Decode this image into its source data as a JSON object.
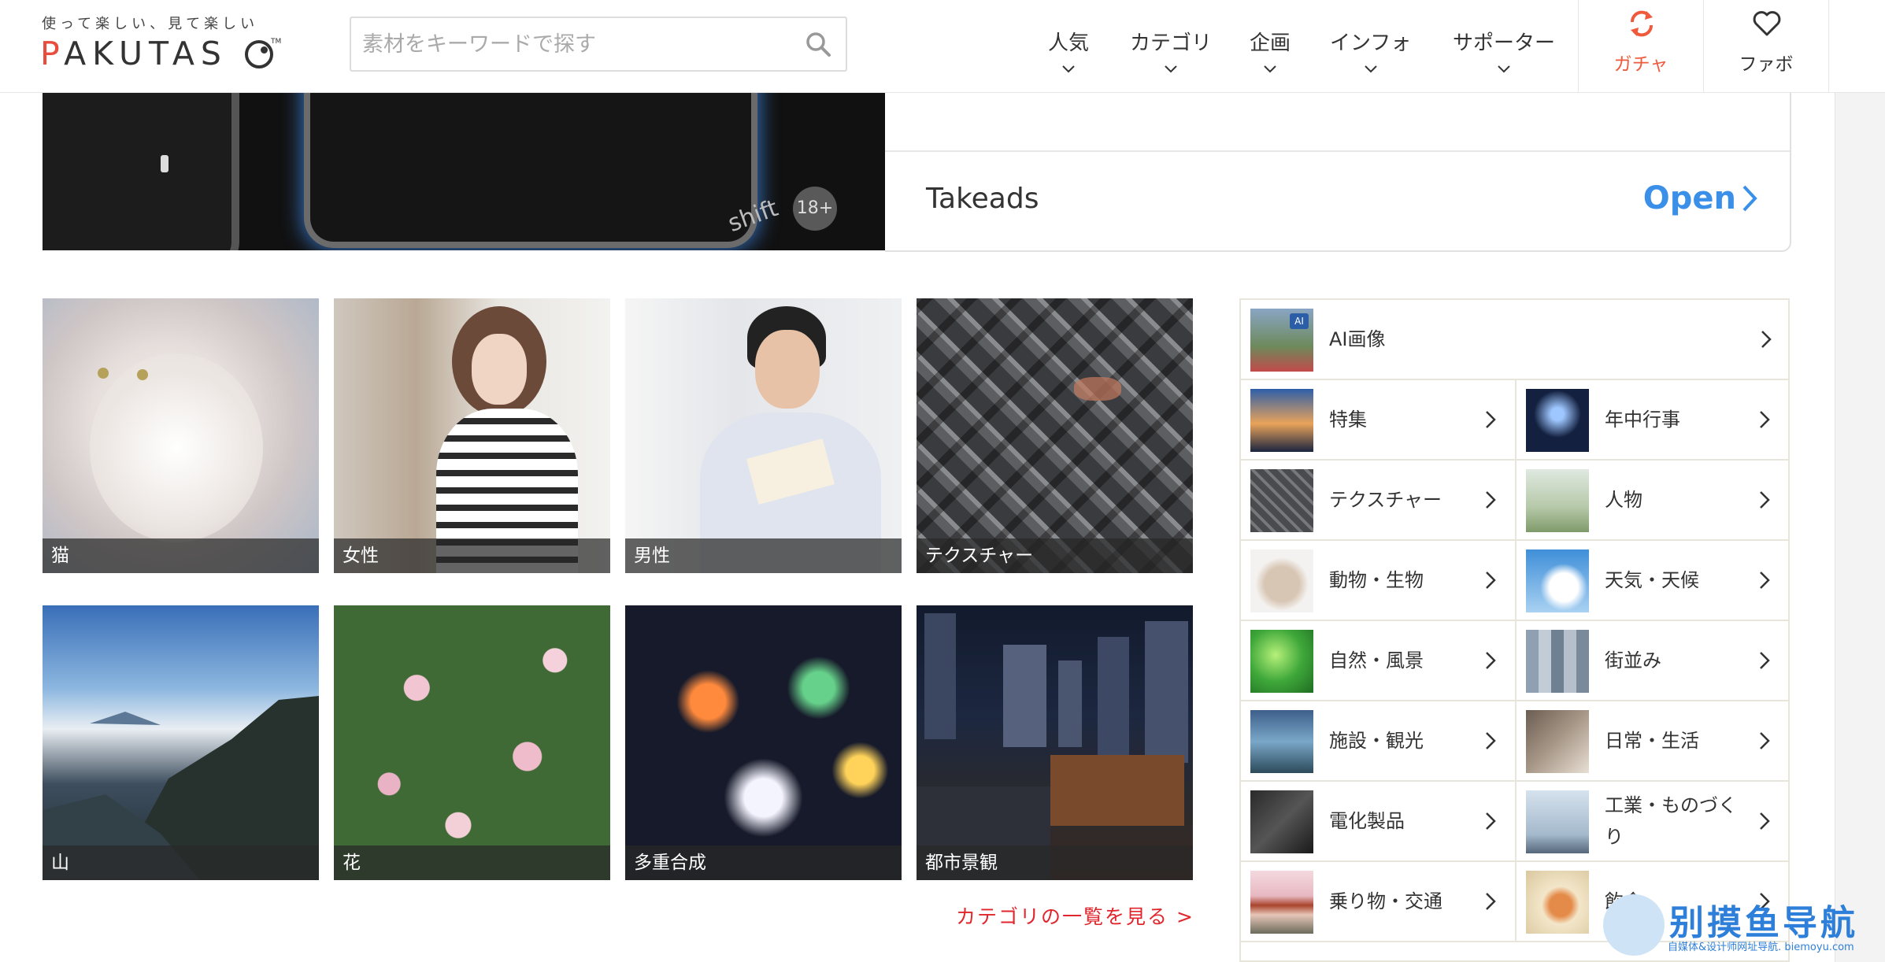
{
  "header": {
    "tagline": "使って楽しい、見て楽しい",
    "logo": "PAKUTASO",
    "tm": "TM",
    "search_placeholder": "素材をキーワードで探す",
    "nav": [
      {
        "label": "人気"
      },
      {
        "label": "カテゴリ"
      },
      {
        "label": "企画"
      },
      {
        "label": "インフォ"
      },
      {
        "label": "サポーター"
      }
    ],
    "gacha_label": "ガチャ",
    "favo_label": "ファボ"
  },
  "banner": {
    "age_badge": "18+",
    "advertiser": "Takeads",
    "cta": "Open"
  },
  "tiles": [
    {
      "caption": "猫"
    },
    {
      "caption": "女性"
    },
    {
      "caption": "男性"
    },
    {
      "caption": "テクスチャー"
    },
    {
      "caption": "山"
    },
    {
      "caption": "花"
    },
    {
      "caption": "多重合成"
    },
    {
      "caption": "都市景観"
    }
  ],
  "more_link": "カテゴリの一覧を見る >",
  "categories": {
    "ai": "AI画像",
    "rows": [
      [
        "特集",
        "年中行事"
      ],
      [
        "テクスチャー",
        "人物"
      ],
      [
        "動物・生物",
        "天気・天候"
      ],
      [
        "自然・風景",
        "街並み"
      ],
      [
        "施設・観光",
        "日常・生活"
      ],
      [
        "電化製品",
        "工業・ものづくり"
      ],
      [
        "乗り物・交通",
        "飲食"
      ]
    ]
  },
  "watermark": {
    "title": "别摸鱼导航",
    "sub": "自媒体&设计师网址导航. biemoyu.com"
  },
  "colors": {
    "brand_red": "#e74c3c",
    "link_red": "#e0262c",
    "ad_blue": "#3a8fe8"
  }
}
